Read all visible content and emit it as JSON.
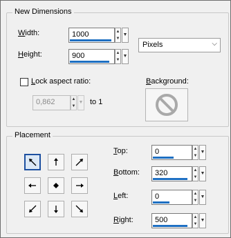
{
  "new_dimensions": {
    "title": "New Dimensions",
    "width": {
      "label_accel": "W",
      "label_rest": "idth:",
      "value": "1000"
    },
    "height": {
      "label_accel": "H",
      "label_rest": "eight:",
      "value": "900"
    },
    "units": {
      "selected": "Pixels"
    },
    "lock_aspect": {
      "label_accel": "L",
      "label_rest": "ock aspect ratio:",
      "checked": false,
      "value": "0,862",
      "to_label": "to 1"
    },
    "background": {
      "label_accel": "B",
      "label_rest": "ackground:"
    }
  },
  "placement": {
    "title": "Placement",
    "anchors": [
      "top-left",
      "top",
      "top-right",
      "left",
      "center",
      "right",
      "bottom-left",
      "bottom",
      "bottom-right"
    ],
    "selected_anchor": "top-left",
    "top": {
      "label_accel": "T",
      "label_rest": "op:",
      "value": "0"
    },
    "bottom": {
      "label_accel": "B",
      "label_rest": "ottom:",
      "value": "320"
    },
    "left": {
      "label_accel": "L",
      "label_rest": "eft:",
      "value": "0"
    },
    "right": {
      "label_accel": "R",
      "label_rest": "ight:",
      "value": "500"
    }
  },
  "colors": {
    "accent": "#1d6fc2",
    "selected_border": "#1c4fa0",
    "no_symbol": "#a9a9a9"
  }
}
